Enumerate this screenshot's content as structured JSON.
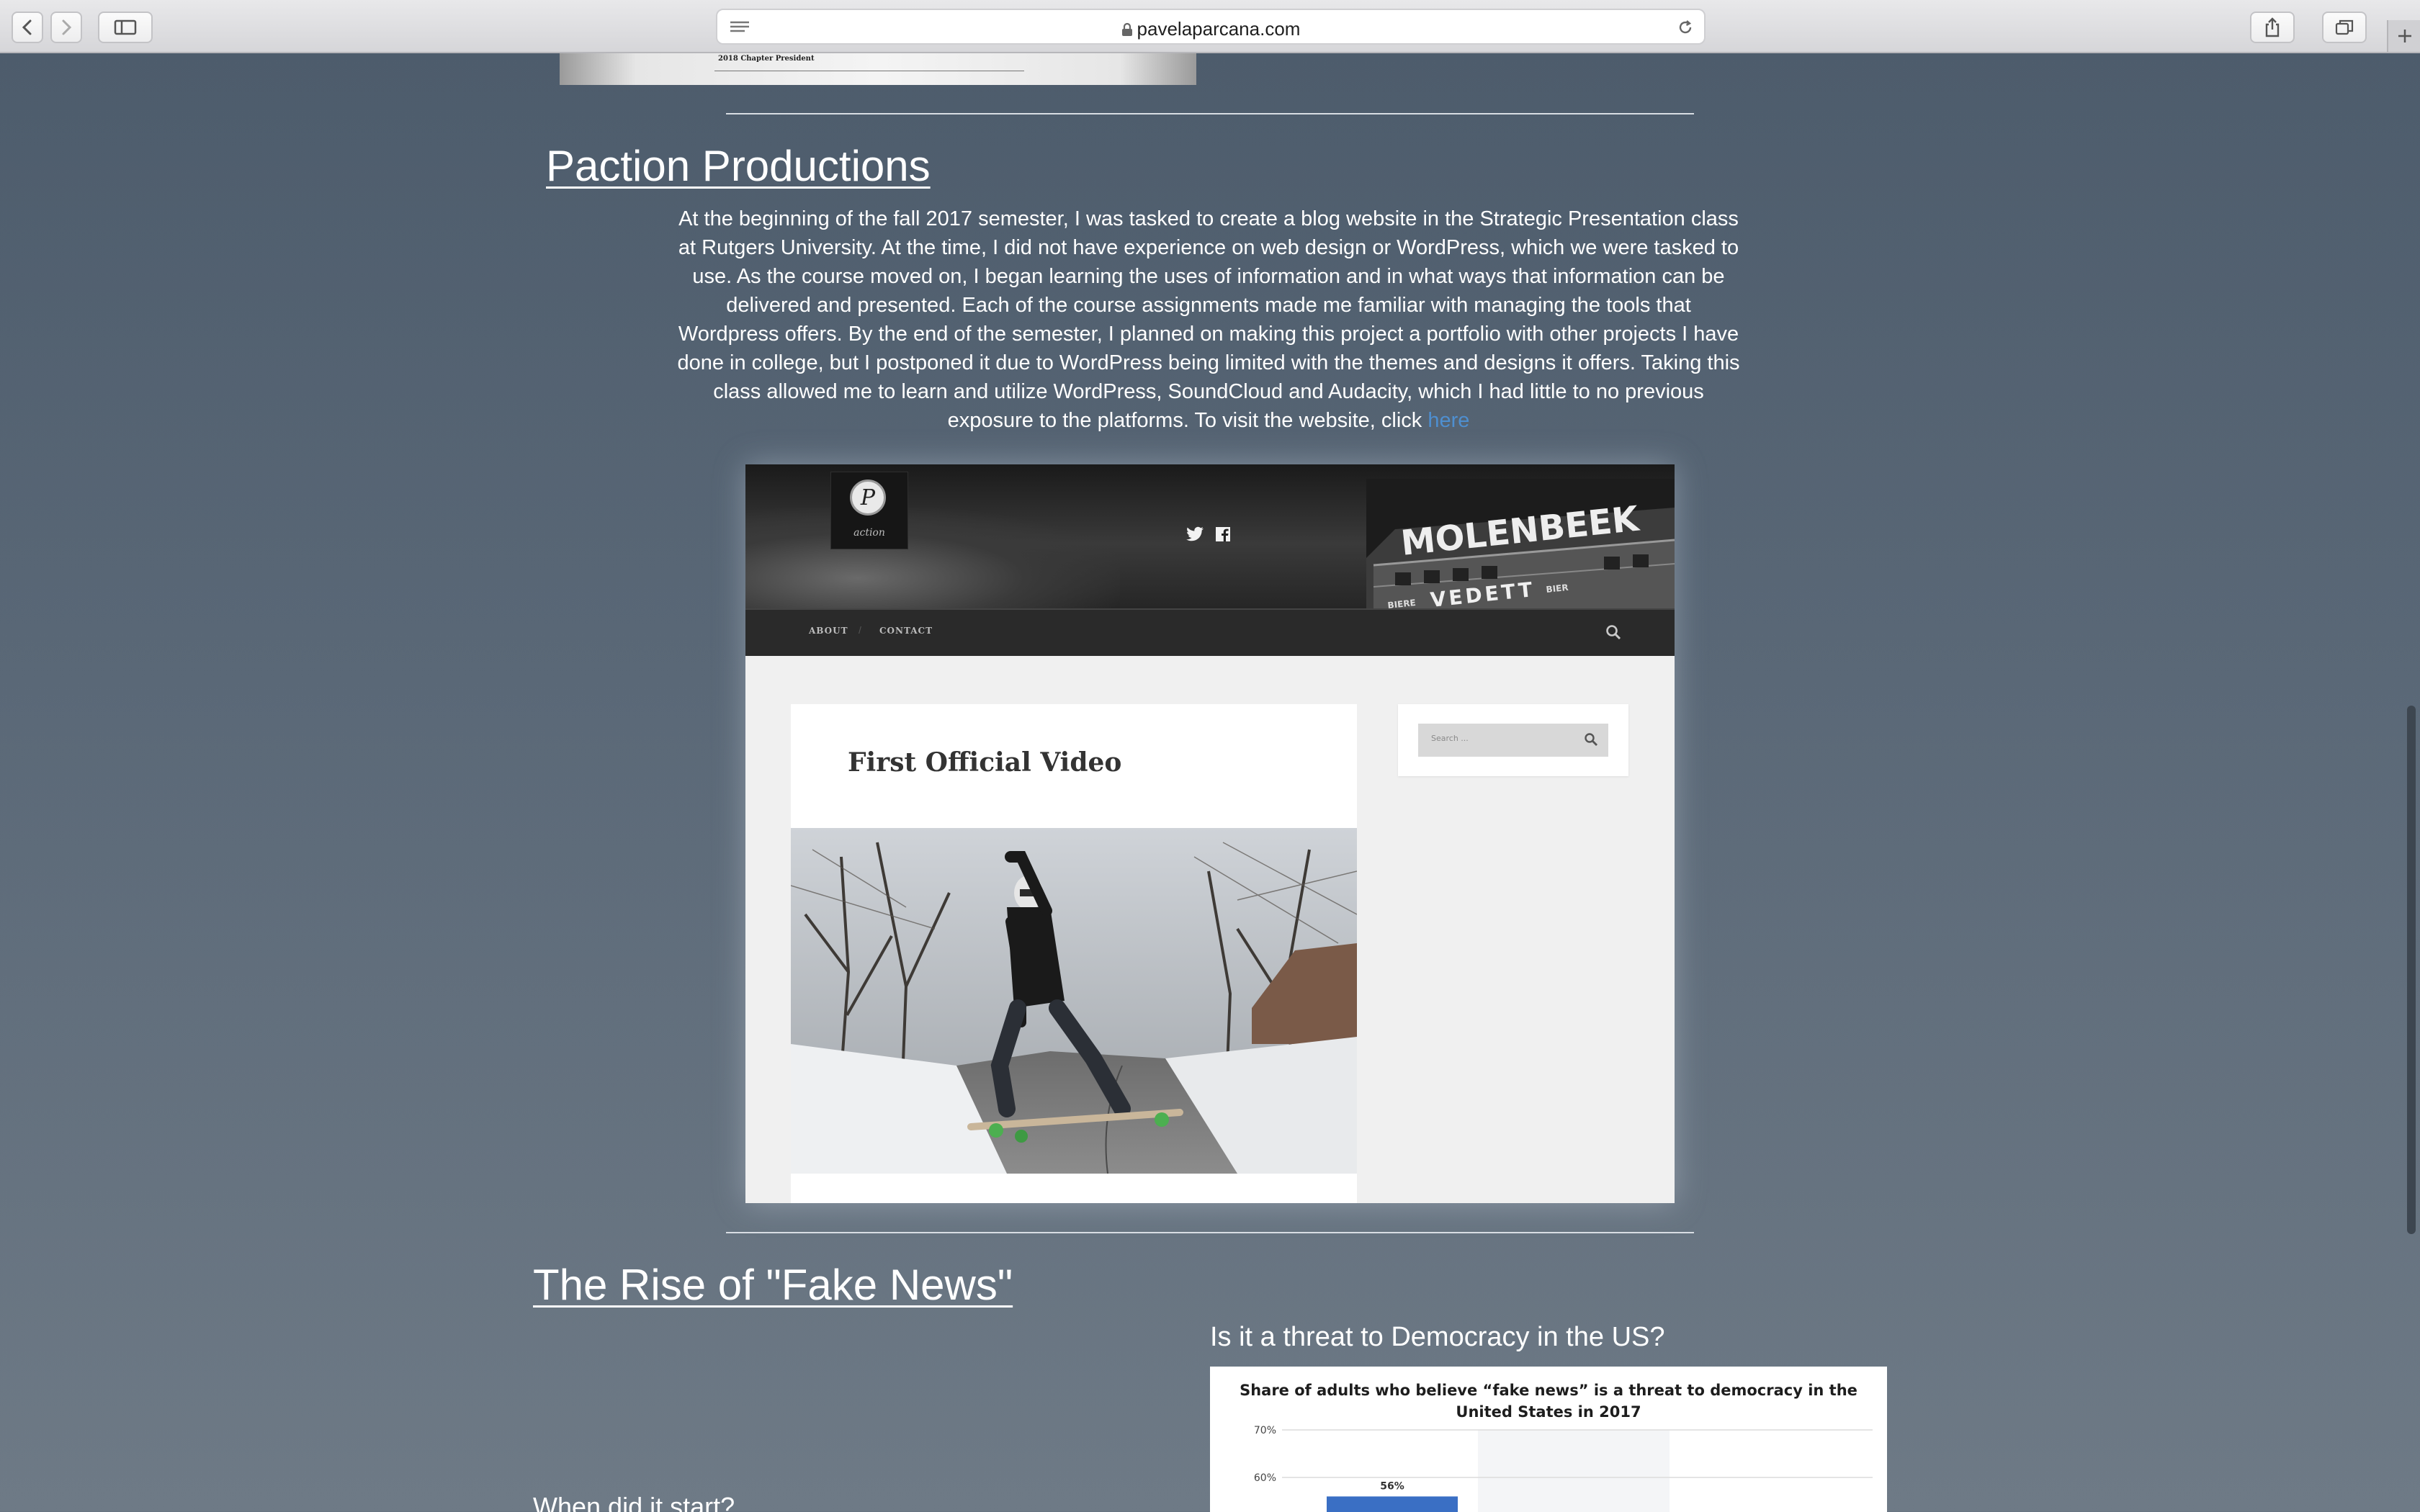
{
  "browser": {
    "url": "pavelaparcana.com",
    "buttons": [
      "back",
      "forward",
      "sidebar",
      "reader",
      "reload",
      "share",
      "tabs",
      "new-tab"
    ]
  },
  "certificate": {
    "text": "2018 Chapter President"
  },
  "section1": {
    "title": "Paction Productions",
    "description": "At the beginning of the fall 2017 semester, I was tasked to create a blog website in the Strategic Presentation class at Rutgers University. At the time, I did not have experience on web design or WordPress, which we were tasked to use. As the course moved on, I began learning the uses of information and in what ways that information can be delivered and presented. Each of the course assignments made me familiar with managing the tools that Wordpress offers. By the end of the semester, I planned on making this project a portfolio with other projects I have done in college, but I postponed it due to WordPress being limited with the themes and designs it offers. Taking this class allowed me to learn and utilize WordPress, SoundCloud and Audacity, which I had little to no previous exposure to the platforms. To visit the website, click ",
    "link_text": "here"
  },
  "embed": {
    "logo_letter": "P",
    "logo_word": "action",
    "building_sign_1": "MOLENBEEK",
    "building_sign_2": "VEDETT",
    "building_sign_3": "BIER",
    "building_sign_4": "BIERE",
    "nav": {
      "about": "ABOUT",
      "separator": "/",
      "contact": "CONTACT"
    },
    "post_title": "First Official Video",
    "search_placeholder": "Search ..."
  },
  "section2": {
    "title": "The Rise of \"Fake News\"",
    "question": "Is it a threat to Democracy in the US?",
    "when_heading": "When did it start?"
  },
  "chart_data": {
    "type": "bar",
    "title": "Share of adults who believe “fake news” is a threat to democracy in the United States in 2017",
    "ytick_labels": [
      "70%",
      "60%"
    ],
    "ylim": [
      0,
      70
    ],
    "categories": [
      ""
    ],
    "values": [
      56
    ],
    "value_labels": [
      "56%"
    ],
    "bar_color": "#3a6fc4",
    "grid": true
  }
}
